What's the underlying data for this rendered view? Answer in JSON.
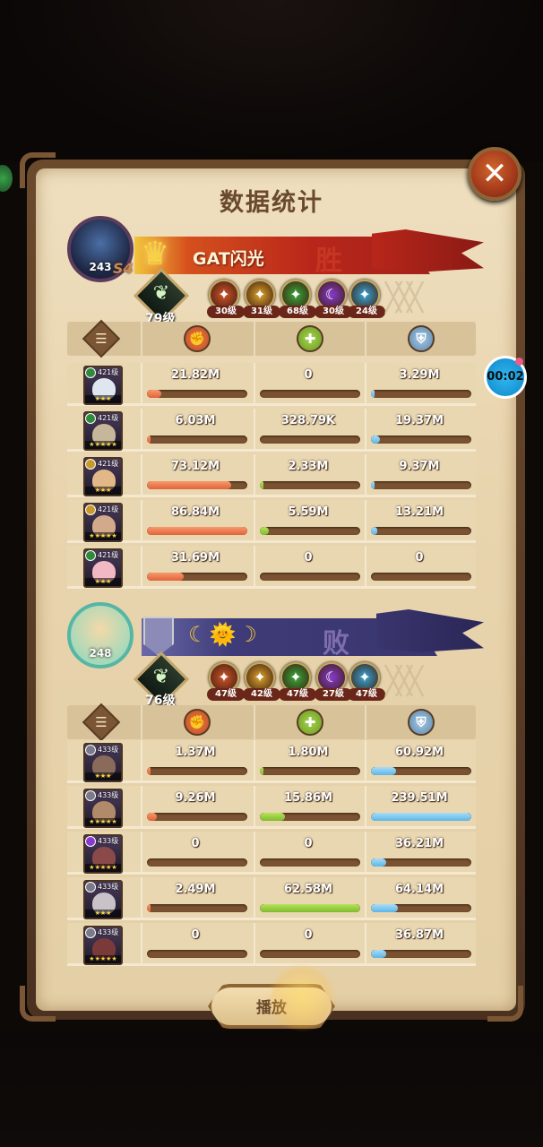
{
  "title": "数据统计",
  "timer": "00:02",
  "play_label": "播放",
  "close_symbol": "✕",
  "player1": {
    "name": "GAT闪光",
    "avatar_level": "243",
    "season": "S4",
    "result": "胜",
    "level": "79级",
    "factions": [
      {
        "label": "30级",
        "color": "#d4532a",
        "symbol": "✦"
      },
      {
        "label": "31级",
        "color": "#e0a42c",
        "symbol": "✦"
      },
      {
        "label": "68级",
        "color": "#3aa83a",
        "symbol": "✦"
      },
      {
        "label": "30级",
        "color": "#8a3ad0",
        "symbol": "☾"
      },
      {
        "label": "24级",
        "color": "#3aa6d6",
        "symbol": "✦"
      }
    ],
    "rows": [
      {
        "hero_level": "421级",
        "stars": "★★★",
        "face": "#dfe6ef",
        "ficon": "#2f8a3a",
        "damage": "21.82M",
        "heal": "0",
        "tank": "3.29M",
        "damage_pct": 0.14,
        "heal_pct": 0.0,
        "tank_pct": 0.03
      },
      {
        "hero_level": "421级",
        "stars": "★★★★★",
        "face": "#c7b79a",
        "ficon": "#2f8a3a",
        "damage": "6.03M",
        "heal": "328.79K",
        "tank": "19.37M",
        "damage_pct": 0.04,
        "heal_pct": 0.0,
        "tank_pct": 0.09
      },
      {
        "hero_level": "421级",
        "stars": "★★★",
        "face": "#e3b889",
        "ficon": "#c79a2a",
        "damage": "73.12M",
        "heal": "2.33M",
        "tank": "9.37M",
        "damage_pct": 0.84,
        "heal_pct": 0.04,
        "tank_pct": 0.04
      },
      {
        "hero_level": "421级",
        "stars": "★★★★★",
        "face": "#d2a98a",
        "ficon": "#c79a2a",
        "damage": "86.84M",
        "heal": "5.59M",
        "tank": "13.21M",
        "damage_pct": 1.0,
        "heal_pct": 0.09,
        "tank_pct": 0.06
      },
      {
        "hero_level": "421级",
        "stars": "★★★",
        "face": "#f2b8c3",
        "ficon": "#2f8a3a",
        "damage": "31.69M",
        "heal": "0",
        "tank": "0",
        "damage_pct": 0.37,
        "heal_pct": 0.0,
        "tank_pct": 0.0
      }
    ]
  },
  "player2": {
    "avatar_level": "248",
    "result": "败",
    "guild_icons": "☾🌞☽",
    "level": "76级",
    "factions": [
      {
        "label": "47级",
        "color": "#d4532a",
        "symbol": "✦"
      },
      {
        "label": "42级",
        "color": "#e0a42c",
        "symbol": "✦"
      },
      {
        "label": "47级",
        "color": "#3aa83a",
        "symbol": "✦"
      },
      {
        "label": "27级",
        "color": "#8a3ad0",
        "symbol": "☾"
      },
      {
        "label": "47级",
        "color": "#3aa6d6",
        "symbol": "✦"
      }
    ],
    "rows": [
      {
        "hero_level": "433级",
        "stars": "★★★",
        "face": "#8a6a5a",
        "ficon": "#7a7a8a",
        "damage": "1.37M",
        "heal": "1.80M",
        "tank": "60.92M",
        "damage_pct": 0.01,
        "heal_pct": 0.03,
        "tank_pct": 0.25
      },
      {
        "hero_level": "433级",
        "stars": "★★★★★",
        "face": "#b08a6a",
        "ficon": "#7a7a8a",
        "damage": "9.26M",
        "heal": "15.86M",
        "tank": "239.51M",
        "damage_pct": 0.1,
        "heal_pct": 0.25,
        "tank_pct": 1.0
      },
      {
        "hero_level": "433级",
        "stars": "★★★★★",
        "face": "#8a4a4a",
        "ficon": "#8a3ad0",
        "damage": "0",
        "heal": "0",
        "tank": "36.21M",
        "damage_pct": 0.0,
        "heal_pct": 0.0,
        "tank_pct": 0.15
      },
      {
        "hero_level": "433级",
        "stars": "★★★",
        "face": "#c9c2c9",
        "ficon": "#7a7a8a",
        "damage": "2.49M",
        "heal": "62.58M",
        "tank": "64.14M",
        "damage_pct": 0.03,
        "heal_pct": 1.0,
        "tank_pct": 0.27
      },
      {
        "hero_level": "433级",
        "stars": "★★★★★",
        "face": "#7a3a3a",
        "ficon": "#7a7a8a",
        "damage": "0",
        "heal": "0",
        "tank": "36.87M",
        "damage_pct": 0.0,
        "heal_pct": 0.0,
        "tank_pct": 0.15
      }
    ]
  },
  "column_icons": [
    "document-icon",
    "damage-icon",
    "heal-icon",
    "tank-icon"
  ]
}
